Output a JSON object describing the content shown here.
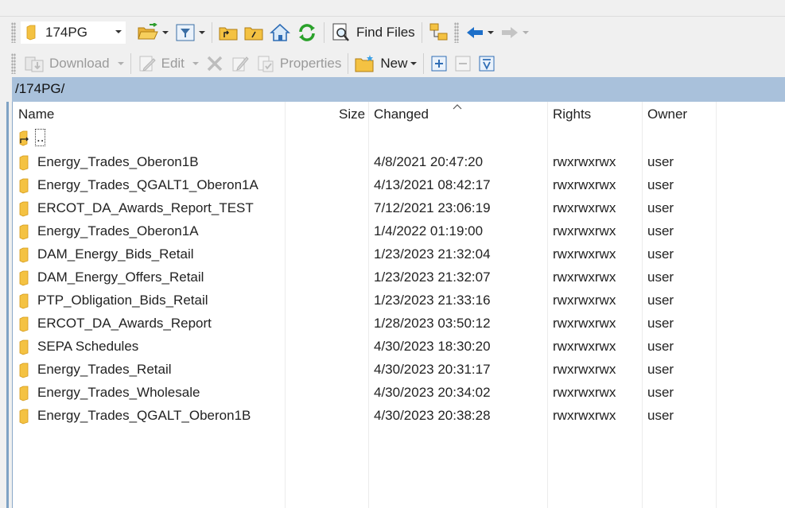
{
  "toolbar_top": {
    "drive": {
      "label": "174PG",
      "icon": "folder-icon"
    },
    "find_files_label": "Find Files",
    "icons": [
      "open-folder-icon",
      "filter-icon",
      "parent-dir-icon",
      "root-dir-icon",
      "home-icon",
      "refresh-icon",
      "find-files-icon",
      "tree-icon",
      "back-arrow-icon",
      "forward-arrow-icon"
    ]
  },
  "toolbar_bottom": {
    "download_label": "Download",
    "edit_label": "Edit",
    "properties_label": "Properties",
    "new_label": "New",
    "icons": [
      "download-icon",
      "edit-icon",
      "delete-icon",
      "rename-icon",
      "properties-icon",
      "new-folder-icon",
      "expand-icon",
      "collapse-icon",
      "select-filter-icon"
    ]
  },
  "path": "/174PG/",
  "columns": {
    "name": "Name",
    "size": "Size",
    "changed": "Changed",
    "rights": "Rights",
    "owner": "Owner"
  },
  "sort": {
    "column": "changed",
    "direction": "ascending"
  },
  "colors": {
    "path_bar": "#a9c1db",
    "folder": "#f4c242",
    "accent": "#1d6fc9"
  },
  "parent_entry": "..",
  "files": [
    {
      "name": "Energy_Trades_Oberon1B",
      "size": "",
      "changed": "4/8/2021 20:47:20",
      "rights": "rwxrwxrwx",
      "owner": "user"
    },
    {
      "name": "Energy_Trades_QGALT1_Oberon1A",
      "size": "",
      "changed": "4/13/2021 08:42:17",
      "rights": "rwxrwxrwx",
      "owner": "user"
    },
    {
      "name": "ERCOT_DA_Awards_Report_TEST",
      "size": "",
      "changed": "7/12/2021 23:06:19",
      "rights": "rwxrwxrwx",
      "owner": "user"
    },
    {
      "name": "Energy_Trades_Oberon1A",
      "size": "",
      "changed": "1/4/2022 01:19:00",
      "rights": "rwxrwxrwx",
      "owner": "user"
    },
    {
      "name": "DAM_Energy_Bids_Retail",
      "size": "",
      "changed": "1/23/2023 21:32:04",
      "rights": "rwxrwxrwx",
      "owner": "user"
    },
    {
      "name": "DAM_Energy_Offers_Retail",
      "size": "",
      "changed": "1/23/2023 21:32:07",
      "rights": "rwxrwxrwx",
      "owner": "user"
    },
    {
      "name": "PTP_Obligation_Bids_Retail",
      "size": "",
      "changed": "1/23/2023 21:33:16",
      "rights": "rwxrwxrwx",
      "owner": "user"
    },
    {
      "name": "ERCOT_DA_Awards_Report",
      "size": "",
      "changed": "1/28/2023 03:50:12",
      "rights": "rwxrwxrwx",
      "owner": "user"
    },
    {
      "name": "SEPA Schedules",
      "size": "",
      "changed": "4/30/2023 18:30:20",
      "rights": "rwxrwxrwx",
      "owner": "user"
    },
    {
      "name": "Energy_Trades_Retail",
      "size": "",
      "changed": "4/30/2023 20:31:17",
      "rights": "rwxrwxrwx",
      "owner": "user"
    },
    {
      "name": "Energy_Trades_Wholesale",
      "size": "",
      "changed": "4/30/2023 20:34:02",
      "rights": "rwxrwxrwx",
      "owner": "user"
    },
    {
      "name": "Energy_Trades_QGALT_Oberon1B",
      "size": "",
      "changed": "4/30/2023 20:38:28",
      "rights": "rwxrwxrwx",
      "owner": "user"
    }
  ]
}
